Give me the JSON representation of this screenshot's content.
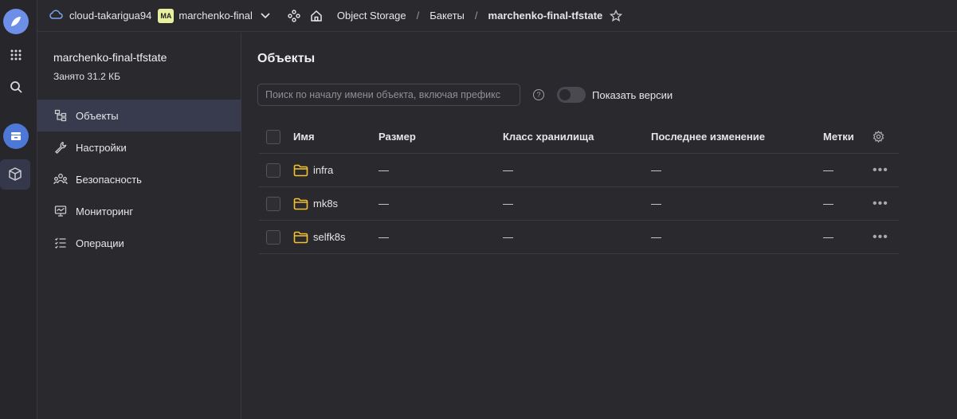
{
  "header": {
    "cloud": "cloud-takarigua94",
    "folder_badge": "MA",
    "folder": "marchenko-final",
    "breadcrumbs": [
      "Object Storage",
      "Бакеты",
      "marchenko-final-tfstate"
    ],
    "separator": "/"
  },
  "sidebar": {
    "bucket_name": "marchenko-final-tfstate",
    "used": "Занято 31.2 КБ",
    "items": [
      {
        "label": "Объекты",
        "icon": "objects-icon",
        "active": true
      },
      {
        "label": "Настройки",
        "icon": "wrench-icon"
      },
      {
        "label": "Безопасность",
        "icon": "users-icon"
      },
      {
        "label": "Мониторинг",
        "icon": "monitor-icon"
      },
      {
        "label": "Операции",
        "icon": "list-icon"
      }
    ]
  },
  "main": {
    "title": "Объекты",
    "search_placeholder": "Поиск по началу имени объекта, включая префикс",
    "show_versions": "Показать версии",
    "columns": {
      "name": "Имя",
      "size": "Размер",
      "class": "Класс хранилища",
      "modified": "Последнее изменение",
      "tags": "Метки"
    },
    "rows": [
      {
        "name": "infra",
        "size": "—",
        "class": "—",
        "modified": "—",
        "tags": "—"
      },
      {
        "name": "mk8s",
        "size": "—",
        "class": "—",
        "modified": "—",
        "tags": "—"
      },
      {
        "name": "selfk8s",
        "size": "—",
        "class": "—",
        "modified": "—",
        "tags": "—"
      }
    ]
  },
  "colors": {
    "background": "#2a292e",
    "accent": "#4d78d6",
    "folder_icon": "#f2c230",
    "active_nav": "#383b4e"
  }
}
